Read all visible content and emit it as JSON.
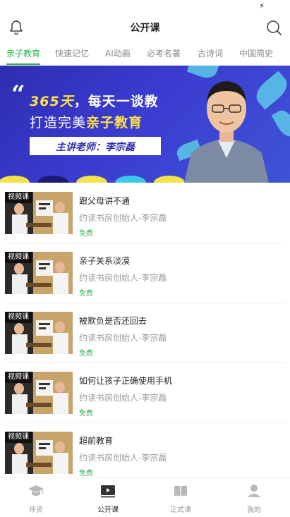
{
  "status_bar": {
    "charging_icon": "bolt-icon"
  },
  "header": {
    "title": "公开课",
    "left_icon": "bell-icon",
    "right_icon": "search-icon"
  },
  "tabs": [
    {
      "label": "亲子教育",
      "active": true
    },
    {
      "label": "快速记忆",
      "active": false
    },
    {
      "label": "AI动画",
      "active": false
    },
    {
      "label": "必考名著",
      "active": false
    },
    {
      "label": "古诗词",
      "active": false
    },
    {
      "label": "中国简史",
      "active": false
    }
  ],
  "banner": {
    "quote_mark": "“",
    "line1_highlight": "365天",
    "line1_rest": "，每天一谈教",
    "line2_plain": "打造完美",
    "line2_highlight": "亲子教育",
    "teacher": "主讲老师：李宗磊"
  },
  "courses": [
    {
      "badge": "视频课",
      "title": "跟父母讲不通",
      "author": "约读书房创始人-李宗磊",
      "price": "免费"
    },
    {
      "badge": "视频课",
      "title": "亲子关系淡漠",
      "author": "约读书房创始人-李宗磊",
      "price": "免费"
    },
    {
      "badge": "视频课",
      "title": "被欺负是否还回去",
      "author": "约读书房创始人-李宗磊",
      "price": "免费"
    },
    {
      "badge": "视频课",
      "title": "如何让孩子正确使用手机",
      "author": "约读书房创始人-李宗磊",
      "price": "免费"
    },
    {
      "badge": "视频课",
      "title": "超前教育",
      "author": "约读书房创始人-李宗磊",
      "price": "免费"
    }
  ],
  "bottom_nav": [
    {
      "label": "师资",
      "icon": "graduation-cap-icon",
      "active": false
    },
    {
      "label": "公开课",
      "icon": "video-play-icon",
      "active": true
    },
    {
      "label": "正式课",
      "icon": "book-icon",
      "active": false
    },
    {
      "label": "我的",
      "icon": "person-icon",
      "active": false
    }
  ],
  "colors": {
    "accent": "#2db24a",
    "banner_blue": "#2d2eb0",
    "banner_yellow": "#ffe14a"
  }
}
